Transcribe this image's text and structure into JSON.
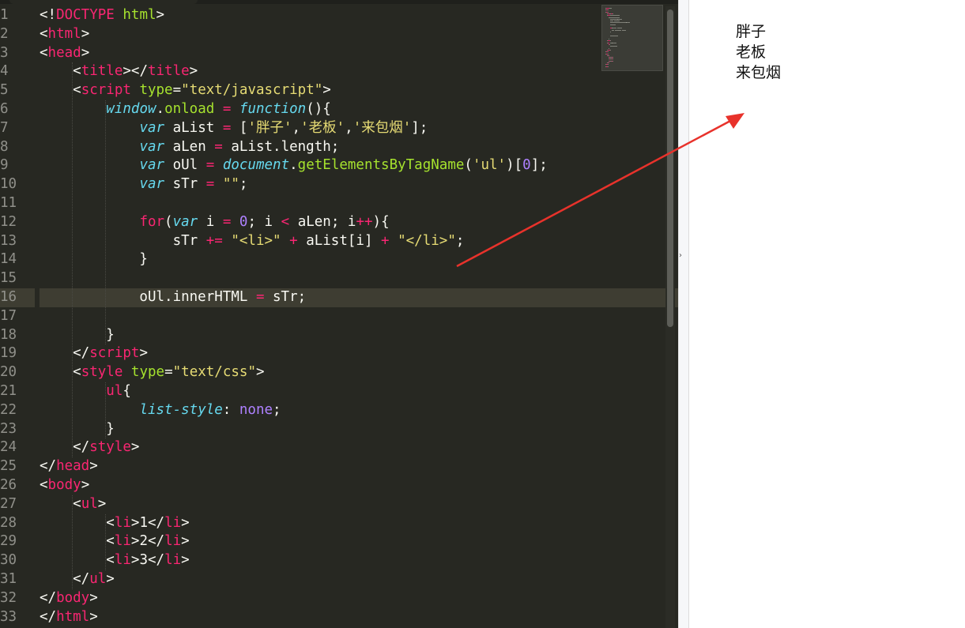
{
  "editor": {
    "active_line": 16,
    "line_numbers": [
      "1",
      "2",
      "3",
      "4",
      "5",
      "6",
      "7",
      "8",
      "9",
      "10",
      "11",
      "12",
      "13",
      "14",
      "15",
      "16",
      "17",
      "18",
      "19",
      "20",
      "21",
      "22",
      "23",
      "24",
      "25",
      "26",
      "27",
      "28",
      "29",
      "30",
      "31",
      "32",
      "33"
    ],
    "lines": [
      [
        [
          "p",
          "<!"
        ],
        [
          "t",
          "DOCTYPE"
        ],
        [
          "p",
          " "
        ],
        [
          "a",
          "html"
        ],
        [
          "p",
          ">"
        ]
      ],
      [
        [
          "p",
          "<"
        ],
        [
          "t",
          "html"
        ],
        [
          "p",
          ">"
        ]
      ],
      [
        [
          "p",
          "<"
        ],
        [
          "t",
          "head"
        ],
        [
          "p",
          ">"
        ]
      ],
      [
        [
          "p",
          "    <"
        ],
        [
          "t",
          "title"
        ],
        [
          "p",
          "></"
        ],
        [
          "t",
          "title"
        ],
        [
          "p",
          ">"
        ]
      ],
      [
        [
          "p",
          "    <"
        ],
        [
          "t",
          "script"
        ],
        [
          "p",
          " "
        ],
        [
          "a",
          "type"
        ],
        [
          "p",
          "="
        ],
        [
          "s",
          "\"text/javascript\""
        ],
        [
          "p",
          ">"
        ]
      ],
      [
        [
          "p",
          "        "
        ],
        [
          "k",
          "window"
        ],
        [
          "p",
          "."
        ],
        [
          "f",
          "onload"
        ],
        [
          "p",
          " "
        ],
        [
          "o",
          "="
        ],
        [
          "p",
          " "
        ],
        [
          "k",
          "function"
        ],
        [
          "p",
          "(){"
        ]
      ],
      [
        [
          "p",
          "            "
        ],
        [
          "k",
          "var"
        ],
        [
          "p",
          " aList "
        ],
        [
          "o",
          "="
        ],
        [
          "p",
          " ["
        ],
        [
          "s",
          "'胖子'"
        ],
        [
          "p",
          ","
        ],
        [
          "s",
          "'老板'"
        ],
        [
          "p",
          ","
        ],
        [
          "s",
          "'来包烟'"
        ],
        [
          "p",
          "];"
        ]
      ],
      [
        [
          "p",
          "            "
        ],
        [
          "k",
          "var"
        ],
        [
          "p",
          " aLen "
        ],
        [
          "o",
          "="
        ],
        [
          "p",
          " aList.length;"
        ]
      ],
      [
        [
          "p",
          "            "
        ],
        [
          "k",
          "var"
        ],
        [
          "p",
          " oUl "
        ],
        [
          "o",
          "="
        ],
        [
          "p",
          " "
        ],
        [
          "k",
          "document"
        ],
        [
          "p",
          "."
        ],
        [
          "f",
          "getElementsByTagName"
        ],
        [
          "p",
          "("
        ],
        [
          "s",
          "'ul'"
        ],
        [
          "p",
          ")["
        ],
        [
          "n",
          "0"
        ],
        [
          "p",
          "];"
        ]
      ],
      [
        [
          "p",
          "            "
        ],
        [
          "k",
          "var"
        ],
        [
          "p",
          " sTr "
        ],
        [
          "o",
          "="
        ],
        [
          "p",
          " "
        ],
        [
          "s",
          "\"\""
        ],
        [
          "p",
          ";"
        ]
      ],
      [
        [
          "p",
          ""
        ]
      ],
      [
        [
          "p",
          "            "
        ],
        [
          "t",
          "for"
        ],
        [
          "p",
          "("
        ],
        [
          "k",
          "var"
        ],
        [
          "p",
          " i "
        ],
        [
          "o",
          "="
        ],
        [
          "p",
          " "
        ],
        [
          "n",
          "0"
        ],
        [
          "p",
          "; i "
        ],
        [
          "o",
          "<"
        ],
        [
          "p",
          " aLen; i"
        ],
        [
          "o",
          "++"
        ],
        [
          "p",
          "){"
        ]
      ],
      [
        [
          "p",
          "                sTr "
        ],
        [
          "o",
          "+="
        ],
        [
          "p",
          " "
        ],
        [
          "s",
          "\"<li>\""
        ],
        [
          "p",
          " "
        ],
        [
          "o",
          "+"
        ],
        [
          "p",
          " aList[i] "
        ],
        [
          "o",
          "+"
        ],
        [
          "p",
          " "
        ],
        [
          "s",
          "\"</li>\""
        ],
        [
          "p",
          ";"
        ]
      ],
      [
        [
          "p",
          "            }"
        ]
      ],
      [
        [
          "p",
          ""
        ]
      ],
      [
        [
          "p",
          "            oUl.innerHTML "
        ],
        [
          "o",
          "="
        ],
        [
          "p",
          " sTr;"
        ]
      ],
      [
        [
          "p",
          ""
        ]
      ],
      [
        [
          "p",
          "        }"
        ]
      ],
      [
        [
          "p",
          "    </"
        ],
        [
          "t",
          "script"
        ],
        [
          "p",
          ">"
        ]
      ],
      [
        [
          "p",
          "    <"
        ],
        [
          "t",
          "style"
        ],
        [
          "p",
          " "
        ],
        [
          "a",
          "type"
        ],
        [
          "p",
          "="
        ],
        [
          "s",
          "\"text/css\""
        ],
        [
          "p",
          ">"
        ]
      ],
      [
        [
          "p",
          "        "
        ],
        [
          "t",
          "ul"
        ],
        [
          "p",
          "{"
        ]
      ],
      [
        [
          "p",
          "            "
        ],
        [
          "k",
          "list-style"
        ],
        [
          "p",
          ": "
        ],
        [
          "k2",
          "none"
        ],
        [
          "p",
          ";"
        ]
      ],
      [
        [
          "p",
          "        }"
        ]
      ],
      [
        [
          "p",
          "    </"
        ],
        [
          "t",
          "style"
        ],
        [
          "p",
          ">"
        ]
      ],
      [
        [
          "p",
          "</"
        ],
        [
          "t",
          "head"
        ],
        [
          "p",
          ">"
        ]
      ],
      [
        [
          "p",
          "<"
        ],
        [
          "t",
          "body"
        ],
        [
          "p",
          ">"
        ]
      ],
      [
        [
          "p",
          "    <"
        ],
        [
          "t",
          "ul"
        ],
        [
          "p",
          ">"
        ]
      ],
      [
        [
          "p",
          "        <"
        ],
        [
          "t",
          "li"
        ],
        [
          "p",
          ">1</"
        ],
        [
          "t",
          "li"
        ],
        [
          "p",
          ">"
        ]
      ],
      [
        [
          "p",
          "        <"
        ],
        [
          "t",
          "li"
        ],
        [
          "p",
          ">2</"
        ],
        [
          "t",
          "li"
        ],
        [
          "p",
          ">"
        ]
      ],
      [
        [
          "p",
          "        <"
        ],
        [
          "t",
          "li"
        ],
        [
          "p",
          ">3</"
        ],
        [
          "t",
          "li"
        ],
        [
          "p",
          ">"
        ]
      ],
      [
        [
          "p",
          "    </"
        ],
        [
          "t",
          "ul"
        ],
        [
          "p",
          ">"
        ]
      ],
      [
        [
          "p",
          "</"
        ],
        [
          "t",
          "body"
        ],
        [
          "p",
          ">"
        ]
      ],
      [
        [
          "p",
          "</"
        ],
        [
          "t",
          "html"
        ],
        [
          "p",
          ">"
        ]
      ]
    ]
  },
  "preview": {
    "items": [
      "胖子",
      "老板",
      "来包烟"
    ]
  },
  "colors": {
    "editor_bg": "#272822",
    "tag": "#f92672",
    "attr": "#a6e22e",
    "string": "#e6db74",
    "number": "#ae81ff",
    "keyword": "#66d9ef",
    "arrow": "#e8322b"
  }
}
